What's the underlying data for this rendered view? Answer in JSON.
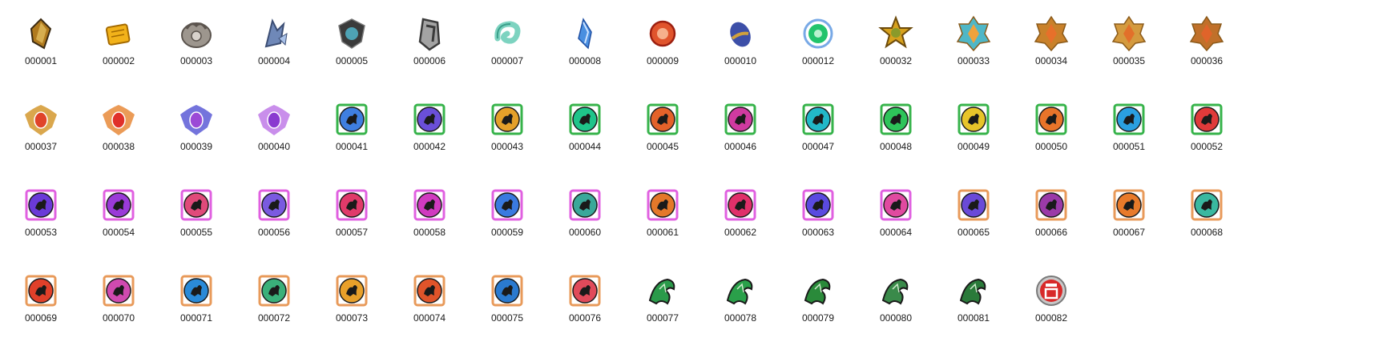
{
  "files": [
    {
      "name": "000001",
      "kind": "crystal",
      "color": "#b07a1e",
      "accent": "#3b2a12"
    },
    {
      "name": "000002",
      "kind": "scroll",
      "color": "#f2b21a",
      "accent": "#a46a00"
    },
    {
      "name": "000003",
      "kind": "metal-emblem",
      "color": "#9d968e",
      "accent": "#5b544e"
    },
    {
      "name": "000004",
      "kind": "blue-ornament",
      "color": "#6f88b8",
      "accent": "#3c4e74"
    },
    {
      "name": "000005",
      "kind": "emblem",
      "color": "#4ea3b5",
      "accent": "#3b3b3b"
    },
    {
      "name": "000006",
      "kind": "shield",
      "color": "#a3a3a3",
      "accent": "#3a3a3a"
    },
    {
      "name": "000007",
      "kind": "swirl",
      "color": "#7dd3c0",
      "accent": "#3a9f8a"
    },
    {
      "name": "000008",
      "kind": "blue-shard",
      "color": "#4a8fe0",
      "accent": "#1f4fa3"
    },
    {
      "name": "000009",
      "kind": "orb",
      "color": "#e0542c",
      "accent": "#9c1f10"
    },
    {
      "name": "000010",
      "kind": "egg",
      "color": "#3c4fa8",
      "accent": "#d0a13c"
    },
    {
      "name": "000012",
      "kind": "green-orb",
      "color": "#22c46c",
      "accent": "#1e6fd6"
    },
    {
      "name": "000032",
      "kind": "gold-star",
      "color": "#d7a11d",
      "accent": "#6c4a0b"
    },
    {
      "name": "000033",
      "kind": "star-badge",
      "color": "#f0a23c",
      "accent": "#4fb7c7"
    },
    {
      "name": "000034",
      "kind": "star-badge",
      "color": "#e7702a",
      "accent": "#c9812a"
    },
    {
      "name": "000035",
      "kind": "star-badge",
      "color": "#e2702a",
      "accent": "#d49a3e"
    },
    {
      "name": "000036",
      "kind": "star-badge",
      "color": "#e0642a",
      "accent": "#c0702a"
    },
    {
      "name": "000037",
      "kind": "crest",
      "color": "#e0442a",
      "accent": "#d4982e"
    },
    {
      "name": "000038",
      "kind": "crest",
      "color": "#e0302a",
      "accent": "#e88a3a"
    },
    {
      "name": "000039",
      "kind": "crest",
      "color": "#9b4ad6",
      "accent": "#5c5cd6"
    },
    {
      "name": "000040",
      "kind": "crest",
      "color": "#8a3ad0",
      "accent": "#c07ae8"
    },
    {
      "name": "000041",
      "kind": "zodiac",
      "color": "#3f7fe0",
      "accent": "#36b34a"
    },
    {
      "name": "000042",
      "kind": "zodiac",
      "color": "#6a4fd8",
      "accent": "#36b34a"
    },
    {
      "name": "000043",
      "kind": "zodiac",
      "color": "#e4a02a",
      "accent": "#36b34a"
    },
    {
      "name": "000044",
      "kind": "zodiac",
      "color": "#1fc48a",
      "accent": "#36b34a"
    },
    {
      "name": "000045",
      "kind": "zodiac",
      "color": "#e4622a",
      "accent": "#36b34a"
    },
    {
      "name": "000046",
      "kind": "zodiac",
      "color": "#d03aa0",
      "accent": "#36b34a"
    },
    {
      "name": "000047",
      "kind": "zodiac",
      "color": "#22b8c8",
      "accent": "#36b34a"
    },
    {
      "name": "000048",
      "kind": "zodiac",
      "color": "#2ec45a",
      "accent": "#36b34a"
    },
    {
      "name": "000049",
      "kind": "zodiac",
      "color": "#e8c42a",
      "accent": "#36b34a"
    },
    {
      "name": "000050",
      "kind": "zodiac",
      "color": "#e8742a",
      "accent": "#36b34a"
    },
    {
      "name": "000051",
      "kind": "zodiac",
      "color": "#2a9fe0",
      "accent": "#36b34a"
    },
    {
      "name": "000052",
      "kind": "zodiac",
      "color": "#e03a3a",
      "accent": "#36b34a"
    },
    {
      "name": "000053",
      "kind": "zodiac",
      "color": "#6a3ad8",
      "accent": "#e060e0"
    },
    {
      "name": "000054",
      "kind": "zodiac",
      "color": "#9a3ad8",
      "accent": "#e060e0"
    },
    {
      "name": "000055",
      "kind": "zodiac",
      "color": "#e04a7a",
      "accent": "#e060e0"
    },
    {
      "name": "000056",
      "kind": "zodiac",
      "color": "#7a5ae0",
      "accent": "#e060e0"
    },
    {
      "name": "000057",
      "kind": "zodiac",
      "color": "#e03a6a",
      "accent": "#e060e0"
    },
    {
      "name": "000058",
      "kind": "zodiac",
      "color": "#d03ac0",
      "accent": "#e060e0"
    },
    {
      "name": "000059",
      "kind": "zodiac",
      "color": "#3a7ae0",
      "accent": "#e060e0"
    },
    {
      "name": "000060",
      "kind": "zodiac",
      "color": "#3aa89a",
      "accent": "#e060e0"
    },
    {
      "name": "000061",
      "kind": "zodiac",
      "color": "#e4782a",
      "accent": "#e060e0"
    },
    {
      "name": "000062",
      "kind": "zodiac",
      "color": "#e0306a",
      "accent": "#e060e0"
    },
    {
      "name": "000063",
      "kind": "zodiac",
      "color": "#5a4ae0",
      "accent": "#e060e0"
    },
    {
      "name": "000064",
      "kind": "zodiac",
      "color": "#e04aa0",
      "accent": "#e060e0"
    },
    {
      "name": "000065",
      "kind": "zodiac",
      "color": "#6a4ad8",
      "accent": "#e89a5a"
    },
    {
      "name": "000066",
      "kind": "zodiac",
      "color": "#9a3aa8",
      "accent": "#e89a5a"
    },
    {
      "name": "000067",
      "kind": "zodiac",
      "color": "#e87a2a",
      "accent": "#e89a5a"
    },
    {
      "name": "000068",
      "kind": "zodiac",
      "color": "#3ab8a0",
      "accent": "#e89a5a"
    },
    {
      "name": "000069",
      "kind": "zodiac",
      "color": "#e0402a",
      "accent": "#e89a5a"
    },
    {
      "name": "000070",
      "kind": "zodiac",
      "color": "#d04ab0",
      "accent": "#e89a5a"
    },
    {
      "name": "000071",
      "kind": "zodiac",
      "color": "#2a8ad8",
      "accent": "#e89a5a"
    },
    {
      "name": "000072",
      "kind": "zodiac",
      "color": "#3ab07a",
      "accent": "#e89a5a"
    },
    {
      "name": "000073",
      "kind": "zodiac",
      "color": "#e8a02a",
      "accent": "#e89a5a"
    },
    {
      "name": "000074",
      "kind": "zodiac",
      "color": "#e0542a",
      "accent": "#e89a5a"
    },
    {
      "name": "000075",
      "kind": "zodiac",
      "color": "#2a7ad0",
      "accent": "#e89a5a"
    },
    {
      "name": "000076",
      "kind": "zodiac",
      "color": "#e04a5a",
      "accent": "#e89a5a"
    },
    {
      "name": "000077",
      "kind": "green-dragon",
      "color": "#2a9a4a",
      "accent": "#1a1a1a"
    },
    {
      "name": "000078",
      "kind": "green-dragon",
      "color": "#2aa04a",
      "accent": "#1a1a1a"
    },
    {
      "name": "000079",
      "kind": "green-dragon",
      "color": "#2a8a3a",
      "accent": "#1a1a1a"
    },
    {
      "name": "000080",
      "kind": "green-dragon",
      "color": "#3a8a4a",
      "accent": "#1a1a1a"
    },
    {
      "name": "000081",
      "kind": "green-dragon",
      "color": "#2a7a3a",
      "accent": "#1a1a1a"
    },
    {
      "name": "000082",
      "kind": "blood-badge",
      "color": "#d82a2a",
      "accent": "#c8c8c8"
    }
  ]
}
